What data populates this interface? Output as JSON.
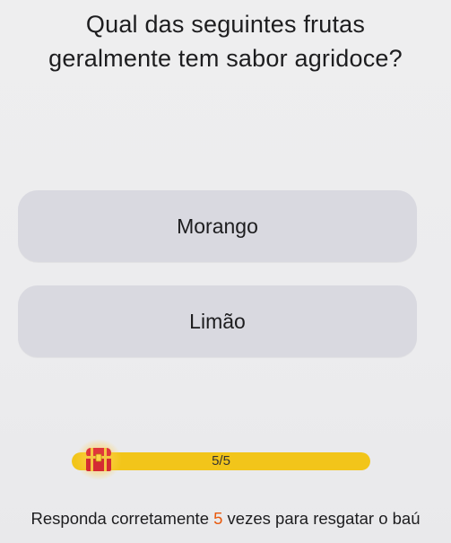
{
  "question": {
    "line1": "Qual das seguintes frutas",
    "line2": "geralmente tem sabor agridoce?"
  },
  "options": [
    {
      "label": "Morango"
    },
    {
      "label": "Limão"
    }
  ],
  "progress": {
    "text": "5/5",
    "current": 5,
    "total": 5,
    "fill_fraction": 1.0,
    "fill_color": "#f2c51a",
    "icon": "treasure-chest-icon"
  },
  "footer": {
    "prefix": "Responda corretamente ",
    "count": "5",
    "suffix": " vezes para resgatar o baú",
    "count_color": "#e8590c"
  }
}
